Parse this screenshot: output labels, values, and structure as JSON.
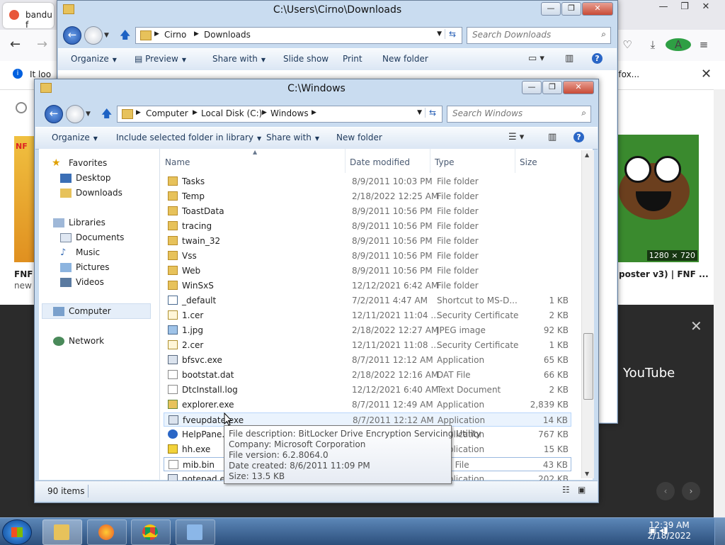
{
  "browser": {
    "tab_label": "bandu f",
    "notification_text": "It loo",
    "notification_text_right": "efox...",
    "caption_left_title": "FNF",
    "caption_left_sub": "new",
    "thumb_left_text": "NF",
    "thumb_right_dims": "1280 × 720",
    "caption_right": "poster v3) | FNF ...",
    "video_label": "YouTube",
    "avatar_letter": "A"
  },
  "downloads_window": {
    "title": "C:\\Users\\Cirno\\Downloads",
    "breadcrumb": [
      "Cirno",
      "Downloads"
    ],
    "search_placeholder": "Search Downloads",
    "toolbar": [
      "Organize",
      "Preview",
      "Share with",
      "Slide show",
      "Print",
      "New folder"
    ]
  },
  "windows_window": {
    "title": "C:\\Windows",
    "breadcrumb": [
      "Computer",
      "Local Disk (C:)",
      "Windows"
    ],
    "search_placeholder": "Search Windows",
    "toolbar": [
      "Organize",
      "Include selected folder in library",
      "Share with",
      "New folder"
    ],
    "nav": {
      "favorites": "Favorites",
      "desktop": "Desktop",
      "downloads": "Downloads",
      "libraries": "Libraries",
      "documents": "Documents",
      "music": "Music",
      "pictures": "Pictures",
      "videos": "Videos",
      "computer": "Computer",
      "network": "Network"
    },
    "columns": [
      "Name",
      "Date modified",
      "Type",
      "Size"
    ],
    "rows": [
      {
        "name": "Tasks",
        "date": "8/9/2011 10:03 PM",
        "type": "File folder",
        "size": "",
        "icon": "folder-icon"
      },
      {
        "name": "Temp",
        "date": "2/18/2022 12:25 AM",
        "type": "File folder",
        "size": "",
        "icon": "folder-icon"
      },
      {
        "name": "ToastData",
        "date": "8/9/2011 10:56 PM",
        "type": "File folder",
        "size": "",
        "icon": "folder-icon"
      },
      {
        "name": "tracing",
        "date": "8/9/2011 10:56 PM",
        "type": "File folder",
        "size": "",
        "icon": "folder-icon"
      },
      {
        "name": "twain_32",
        "date": "8/9/2011 10:56 PM",
        "type": "File folder",
        "size": "",
        "icon": "folder-icon"
      },
      {
        "name": "Vss",
        "date": "8/9/2011 10:56 PM",
        "type": "File folder",
        "size": "",
        "icon": "folder-icon"
      },
      {
        "name": "Web",
        "date": "8/9/2011 10:56 PM",
        "type": "File folder",
        "size": "",
        "icon": "folder-icon"
      },
      {
        "name": "WinSxS",
        "date": "12/12/2021 6:42 AM",
        "type": "File folder",
        "size": "",
        "icon": "folder-icon"
      },
      {
        "name": "_default",
        "date": "7/2/2011 4:47 AM",
        "type": "Shortcut to MS-D...",
        "size": "1 KB",
        "icon": "shortcut-icon"
      },
      {
        "name": "1.cer",
        "date": "12/11/2021 11:04 ...",
        "type": "Security Certificate",
        "size": "2 KB",
        "icon": "certificate-icon"
      },
      {
        "name": "1.jpg",
        "date": "2/18/2022 12:27 AM",
        "type": "JPEG image",
        "size": "92 KB",
        "icon": "image-icon"
      },
      {
        "name": "2.cer",
        "date": "12/11/2021 11:08 ...",
        "type": "Security Certificate",
        "size": "1 KB",
        "icon": "certificate-icon"
      },
      {
        "name": "bfsvc.exe",
        "date": "8/7/2011 12:12 AM",
        "type": "Application",
        "size": "65 KB",
        "icon": "application-icon"
      },
      {
        "name": "bootstat.dat",
        "date": "2/18/2022 12:16 AM",
        "type": "DAT File",
        "size": "66 KB",
        "icon": "file-icon"
      },
      {
        "name": "DtcInstall.log",
        "date": "12/12/2021 6:40 AM",
        "type": "Text Document",
        "size": "2 KB",
        "icon": "file-icon"
      },
      {
        "name": "explorer.exe",
        "date": "8/7/2011 12:49 AM",
        "type": "Application",
        "size": "2,839 KB",
        "icon": "explorer-icon"
      },
      {
        "name": "fveupdate.exe",
        "date": "8/7/2011 12:12 AM",
        "type": "Application",
        "size": "14 KB",
        "icon": "application-icon"
      },
      {
        "name": "HelpPane.exe",
        "date": "",
        "type": "Application",
        "size": "767 KB",
        "icon": "help-icon"
      },
      {
        "name": "hh.exe",
        "date": "",
        "type": "Application",
        "size": "15 KB",
        "icon": "question-help-icon"
      },
      {
        "name": "mib.bin",
        "date": "",
        "type": "BIN File",
        "size": "43 KB",
        "icon": "file-icon"
      },
      {
        "name": "notepad.exe",
        "date": "",
        "type": "Application",
        "size": "202 KB",
        "icon": "application-icon"
      }
    ],
    "status": "90 items",
    "tooltip": [
      "File description: BitLocker Drive Encryption Servicing Utility",
      "Company: Microsoft Corporation",
      "File version: 6.2.8064.0",
      "Date created: 8/6/2011 11:09 PM",
      "Size: 13.5 KB"
    ]
  },
  "taskbar": {
    "time": "12:39 AM",
    "date": "2/18/2022"
  }
}
